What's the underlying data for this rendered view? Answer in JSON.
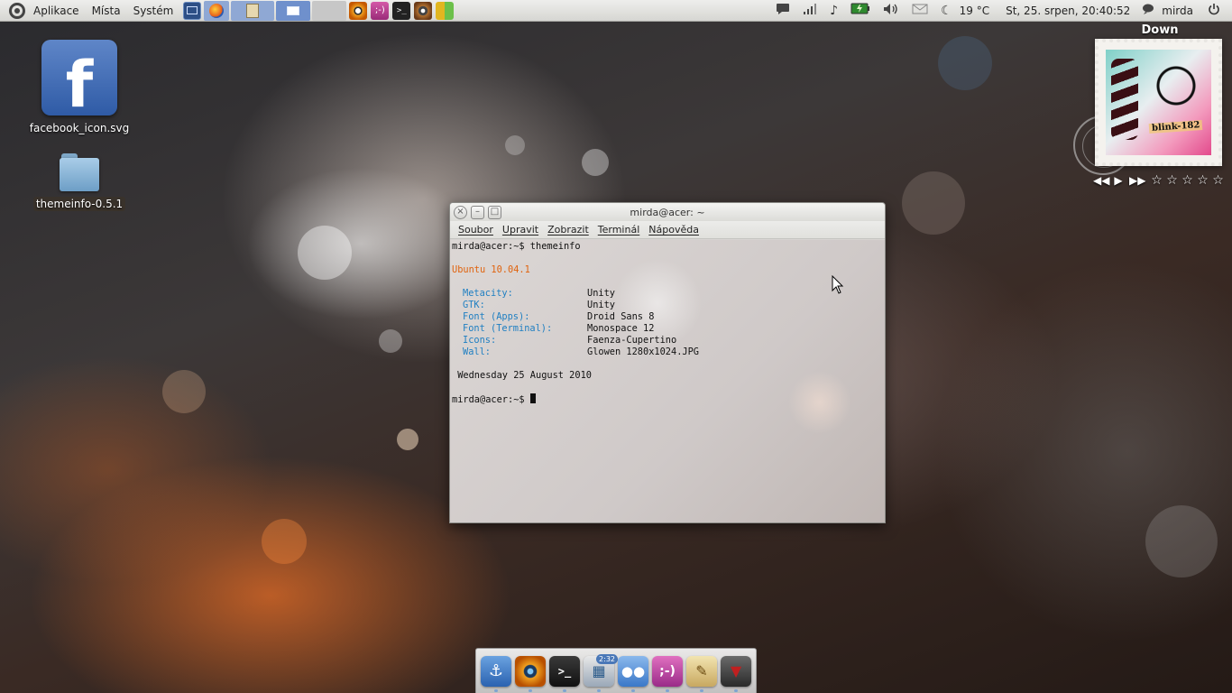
{
  "top_panel": {
    "menus": [
      "Aplikace",
      "Místa",
      "Systém"
    ],
    "weather": "19 °C",
    "datetime": "St, 25. srpen, 20:40:52",
    "user": "mirda"
  },
  "desktop": {
    "icons": [
      {
        "label": "facebook_icon.svg",
        "glyph": "f"
      },
      {
        "label": "themeinfo-0.5.1"
      }
    ]
  },
  "terminal": {
    "title": "mirda@acer: ~",
    "menu": [
      "Soubor",
      "Upravit",
      "Zobrazit",
      "Terminál",
      "Nápověda"
    ],
    "prompt_line": "mirda@acer:~$ themeinfo",
    "distro": "Ubuntu 10.04.1",
    "info": [
      {
        "key": "Metacity:",
        "value": "Unity"
      },
      {
        "key": "GTK:",
        "value": "Unity"
      },
      {
        "key": "Font (Apps):",
        "value": "Droid Sans 8"
      },
      {
        "key": "Font (Terminal):",
        "value": "Monospace 12"
      },
      {
        "key": "Icons:",
        "value": "Faenza-Cupertino"
      },
      {
        "key": "Wall:",
        "value": "Glowen 1280x1024.JPG"
      }
    ],
    "date_line": " Wednesday 25 August 2010",
    "final_prompt": "mirda@acer:~$ "
  },
  "music_widget": {
    "title": "Down",
    "album_logo": "blink-182",
    "controls": [
      "◀◀",
      "▶",
      "▶▶"
    ],
    "rating": 0,
    "rating_max": 5
  },
  "dock": {
    "clock_badge": "2:32"
  }
}
